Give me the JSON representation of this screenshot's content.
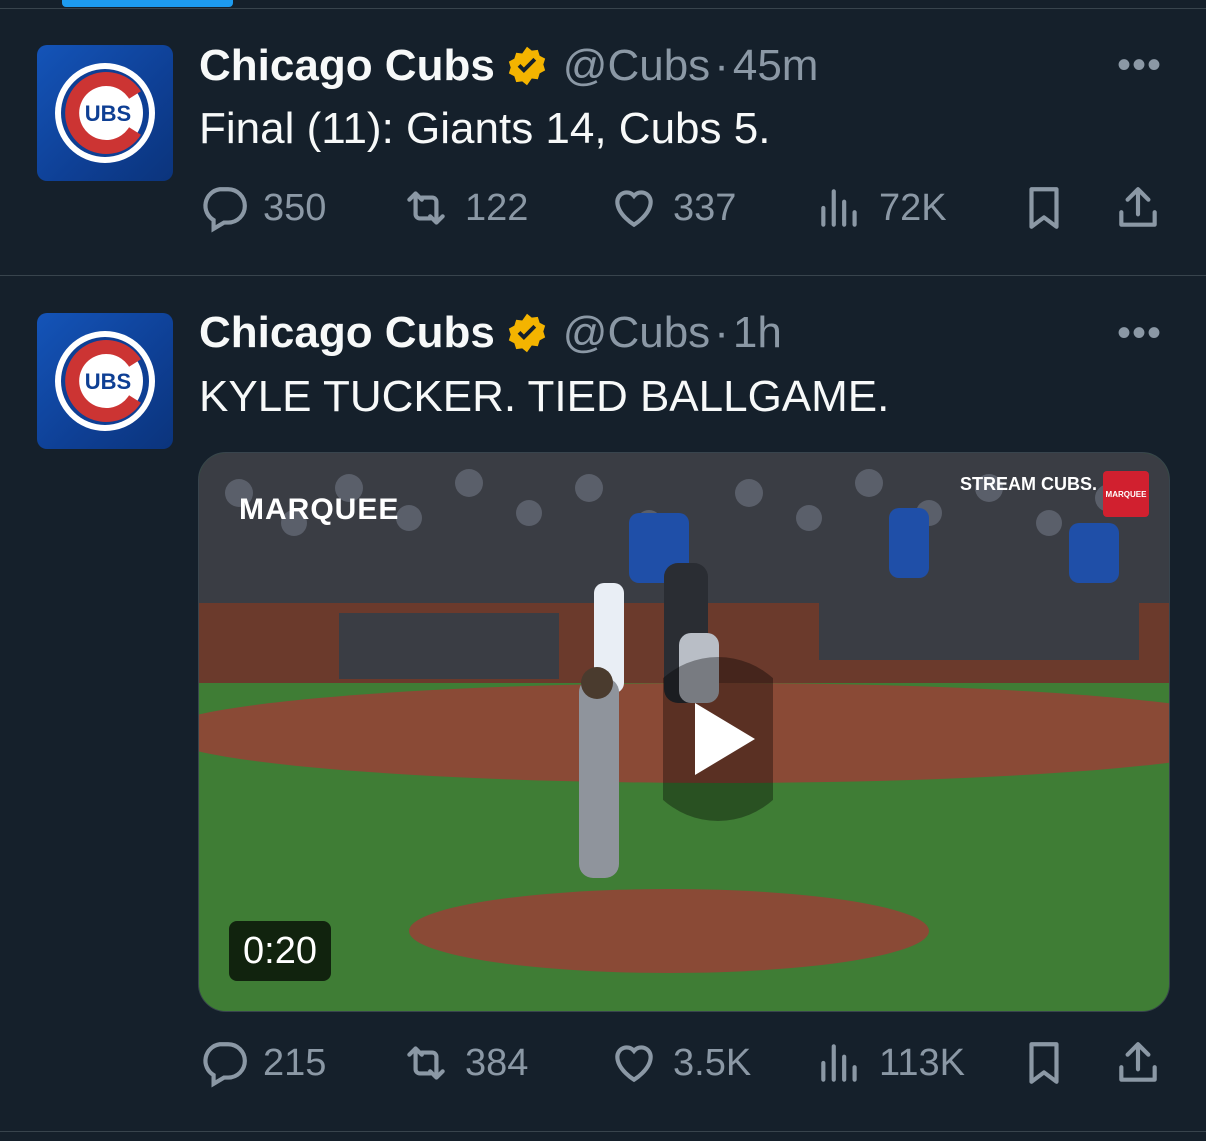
{
  "colors": {
    "background": "#15202b",
    "accent": "#1d9bf0",
    "text": "#f7f9f9",
    "muted": "#8b98a5",
    "verified": "#f4b400",
    "cubs_blue": "#0e3f94",
    "cubs_red": "#cc3433"
  },
  "tweets": [
    {
      "name": "Chicago Cubs",
      "handle": "@Cubs",
      "separator": "·",
      "time": "45m",
      "text": "Final (11): Giants 14, Cubs 5.",
      "stats": {
        "replies": "350",
        "reposts": "122",
        "likes": "337",
        "views": "72K"
      }
    },
    {
      "name": "Chicago Cubs",
      "handle": "@Cubs",
      "separator": "·",
      "time": "1h",
      "text": "KYLE TUCKER. TIED BALLGAME.",
      "video": {
        "duration": "0:20",
        "overlay_left": "MARQUEE",
        "overlay_right": "STREAM CUBS.",
        "overlay_box": "MARQUEE"
      },
      "stats": {
        "replies": "215",
        "reposts": "384",
        "likes": "3.5K",
        "views": "113K"
      }
    }
  ],
  "icons": {
    "more": "ellipsis-icon",
    "reply": "reply-icon",
    "repost": "repost-icon",
    "like": "heart-icon",
    "views": "views-icon",
    "bookmark": "bookmark-icon",
    "share": "share-icon",
    "verified": "verified-badge-icon",
    "play": "play-icon"
  },
  "more_label": "•••"
}
